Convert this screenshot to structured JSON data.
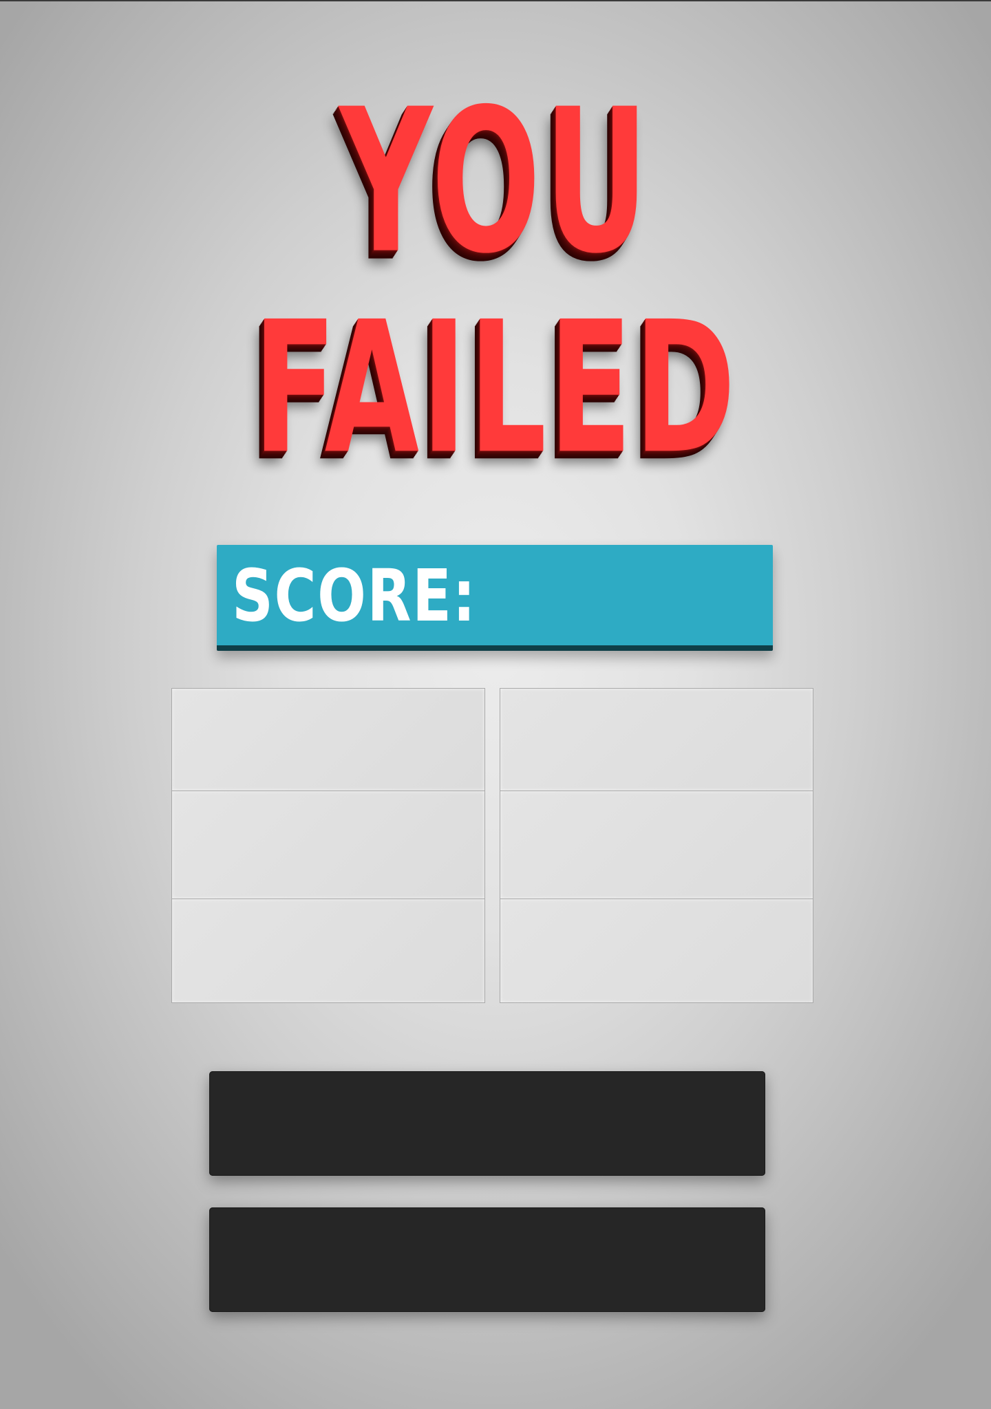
{
  "title": {
    "line1": "YOU",
    "line2": "FAILED"
  },
  "score": {
    "label": "SCORE:",
    "value": ""
  },
  "stats": {
    "left": [
      "",
      "",
      ""
    ],
    "right": [
      "",
      "",
      ""
    ]
  },
  "buttons": {
    "primary_label": "",
    "secondary_label": ""
  },
  "colors": {
    "title": "#ff3a3a",
    "score_bar": "#2eabc4",
    "button": "#262626"
  }
}
